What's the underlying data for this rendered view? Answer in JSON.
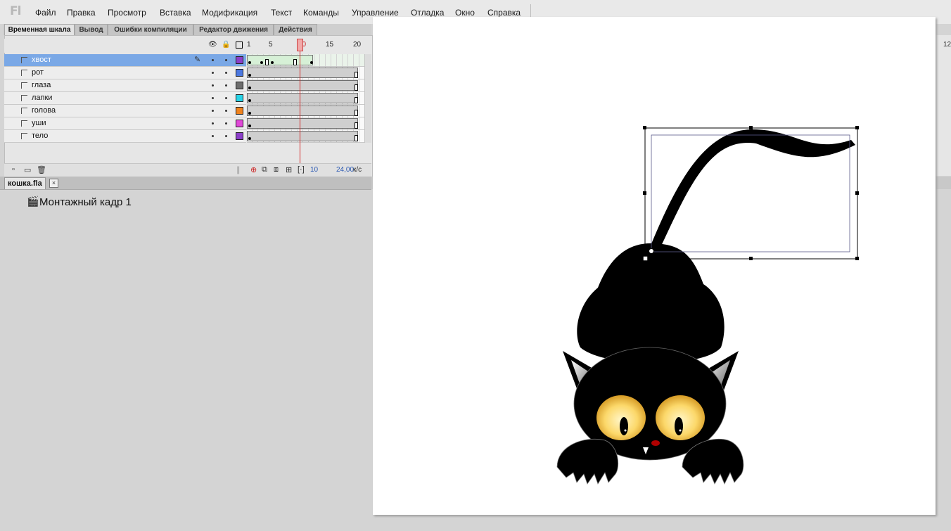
{
  "app": {
    "logo": "Fl"
  },
  "menu": [
    "Файл",
    "Правка",
    "Просмотр",
    "Вставка",
    "Модификация",
    "Текст",
    "Команды",
    "Управление",
    "Отладка",
    "Окно",
    "Справка"
  ],
  "panel_tabs": [
    "Временная шкала",
    "Вывод",
    "Ошибки компиляции",
    "Редактор движения",
    "Действия"
  ],
  "timeline": {
    "frame_numbers": [
      "1",
      "5",
      "10",
      "15",
      "20"
    ],
    "current_frame": "10",
    "fps": "24,00",
    "fps_unit": "к/с",
    "layers": [
      {
        "name": "хвост",
        "color": "#8b3fc9",
        "selected": true
      },
      {
        "name": "рот",
        "color": "#4c78e0",
        "selected": false
      },
      {
        "name": "глаза",
        "color": "#6e6e6e",
        "selected": false
      },
      {
        "name": "лапки",
        "color": "#27d3e6",
        "selected": false
      },
      {
        "name": "голова",
        "color": "#f0831e",
        "selected": false
      },
      {
        "name": "уши",
        "color": "#e148d8",
        "selected": false
      },
      {
        "name": "тело",
        "color": "#8b3fc9",
        "selected": false
      }
    ]
  },
  "document": {
    "tab": "кошка.fla",
    "close": "×",
    "scene": "Монтажный кадр 1"
  },
  "right_ruler": {
    "num": "12"
  }
}
